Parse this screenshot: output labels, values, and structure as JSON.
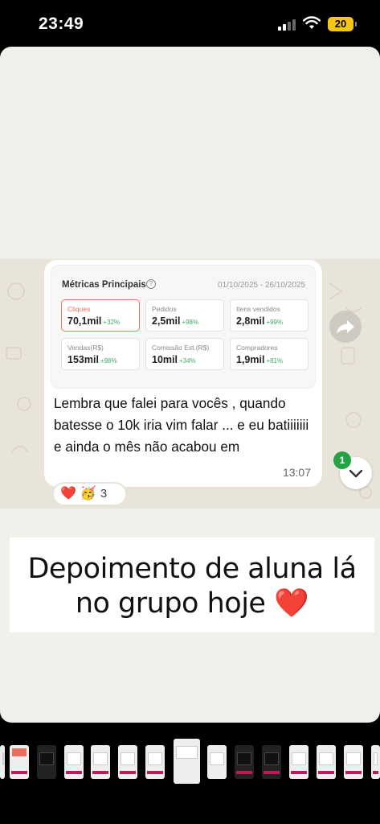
{
  "status_bar": {
    "time": "23:49",
    "battery": "20"
  },
  "metrics": {
    "title": "Métricas Principais",
    "date_range": "01/10/2025 - 26/10/2025",
    "cards": [
      {
        "label": "Cliques",
        "value": "70,1mil",
        "change": "+32%",
        "active": true
      },
      {
        "label": "Pedidos",
        "value": "2,5mil",
        "change": "+98%"
      },
      {
        "label": "Itens vendidos",
        "value": "2,8mil",
        "change": "+99%"
      },
      {
        "label": "Vendas(R$)",
        "value": "153mil",
        "change": "+98%"
      },
      {
        "label": "Comissão Est.(R$)",
        "value": "10mil",
        "change": "+34%"
      },
      {
        "label": "Compradores",
        "value": "1,9mil",
        "change": "+81%"
      }
    ]
  },
  "message": {
    "text": "Lembra que falei para vocês , quando batesse o 10k iria vim falar ... e eu batiiiiiii e ainda o mês não acabou em",
    "time": "13:07"
  },
  "reactions": {
    "emojis": [
      "❤️",
      "🥳"
    ],
    "count": "3"
  },
  "unread_badge": "1",
  "caption": "Depoimento de aluna lá no grupo hoje ❤️",
  "colors": {
    "accent": "#e8705a",
    "positive": "#3daa5c",
    "badge": "#25a244"
  },
  "icons": {
    "forward": "forward-arrow-icon",
    "scroll_down": "chevron-down-icon",
    "info": "info-icon"
  }
}
